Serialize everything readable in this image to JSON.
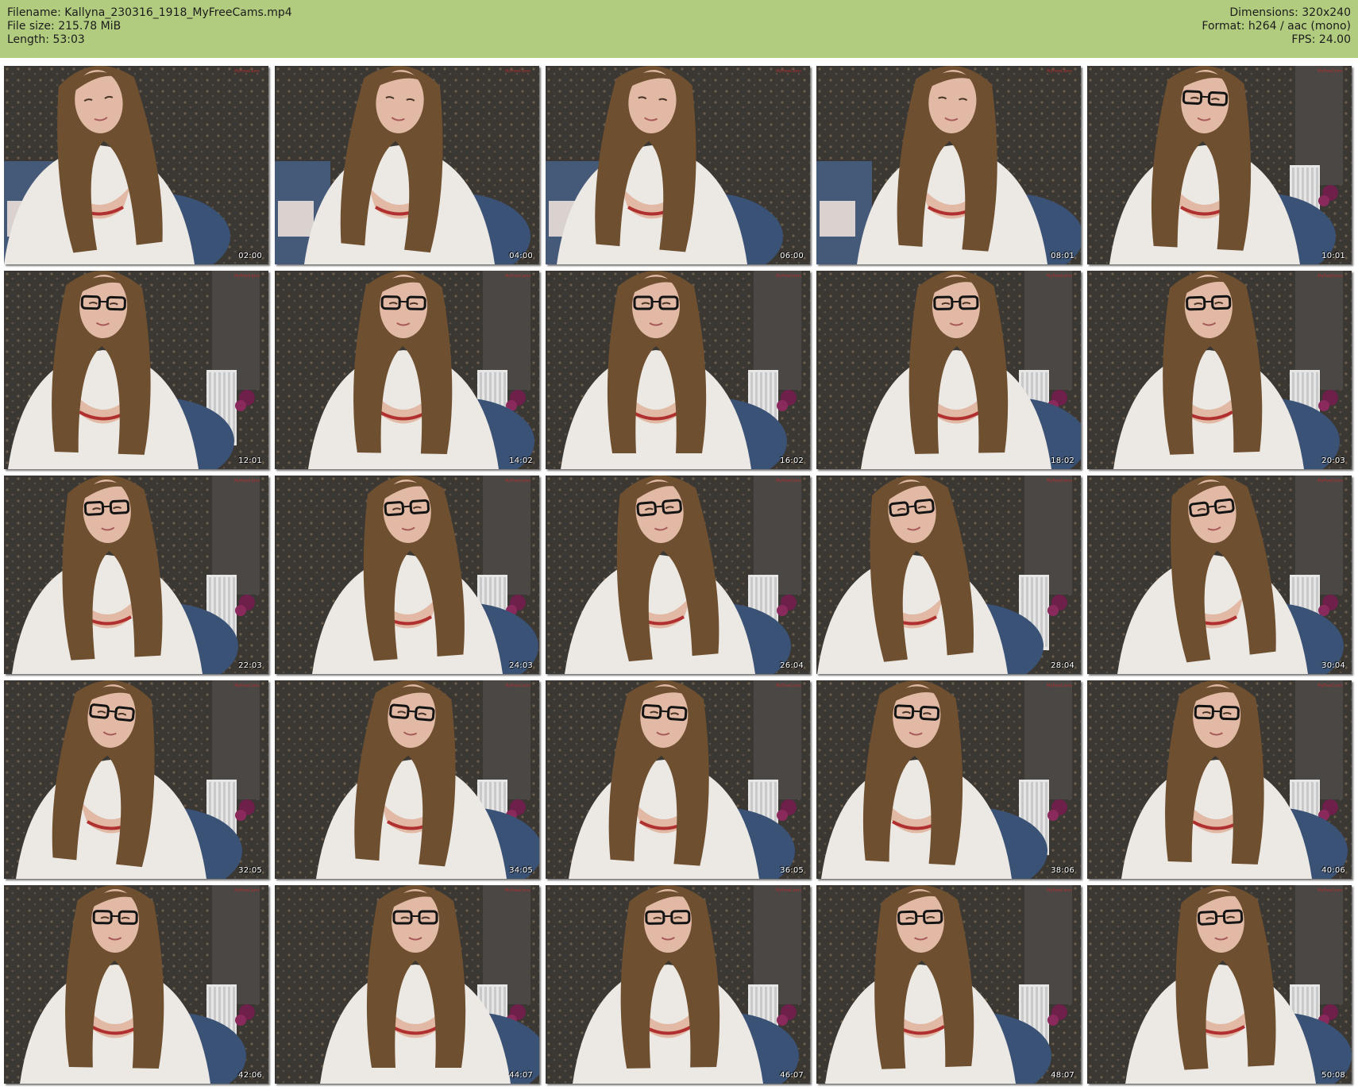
{
  "header": {
    "filename_line": "Filename: Kallyna_230316_1918_MyFreeCams.mp4",
    "filesize_line": "File size: 215.78 MiB",
    "length_line": "Length: 53:03",
    "dimensions_line": "Dimensions: 320x240",
    "format_line": "Format: h264 / aac (mono)",
    "fps_line": "FPS: 24.00"
  },
  "colors": {
    "header_bg": "#b2cc7f",
    "wall": "#3b3733",
    "couch": "#3a5275",
    "shirt": "#ece8e4",
    "hair": "#6e5030",
    "skin": "#e1b9a4",
    "accent_red": "#b03030",
    "glasses": "#141414"
  },
  "thumbnails": [
    {
      "time": "02:00",
      "glasses": false
    },
    {
      "time": "04:00",
      "glasses": false
    },
    {
      "time": "06:00",
      "glasses": false
    },
    {
      "time": "08:01",
      "glasses": false
    },
    {
      "time": "10:01",
      "glasses": true
    },
    {
      "time": "12:01",
      "glasses": true
    },
    {
      "time": "14:02",
      "glasses": true
    },
    {
      "time": "16:02",
      "glasses": true
    },
    {
      "time": "18:02",
      "glasses": true
    },
    {
      "time": "20:03",
      "glasses": true
    },
    {
      "time": "22:03",
      "glasses": true
    },
    {
      "time": "24:03",
      "glasses": true
    },
    {
      "time": "26:04",
      "glasses": true
    },
    {
      "time": "28:04",
      "glasses": true
    },
    {
      "time": "30:04",
      "glasses": true
    },
    {
      "time": "32:05",
      "glasses": true
    },
    {
      "time": "34:05",
      "glasses": true
    },
    {
      "time": "36:05",
      "glasses": true
    },
    {
      "time": "38:06",
      "glasses": true
    },
    {
      "time": "40:06",
      "glasses": true
    },
    {
      "time": "42:06",
      "glasses": true
    },
    {
      "time": "44:07",
      "glasses": true
    },
    {
      "time": "46:07",
      "glasses": true
    },
    {
      "time": "48:07",
      "glasses": true
    },
    {
      "time": "50:08",
      "glasses": true
    }
  ]
}
